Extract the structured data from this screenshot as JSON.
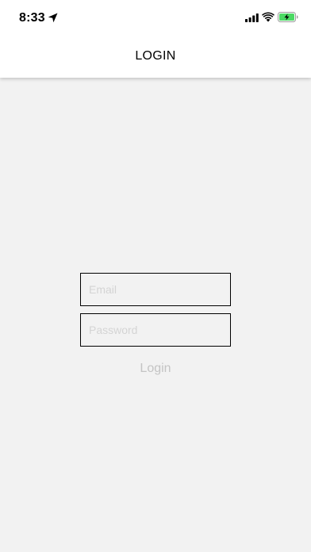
{
  "status_bar": {
    "time": "8:33",
    "icons": [
      "location-arrow-icon",
      "cellular-signal-icon",
      "wifi-icon",
      "battery-charging-icon"
    ],
    "battery_color": "#4cd964"
  },
  "header": {
    "title": "LOGIN"
  },
  "form": {
    "email_placeholder": "Email",
    "email_value": "",
    "password_placeholder": "Password",
    "password_value": "",
    "login_label": "Login"
  },
  "colors": {
    "background": "#f2f2f2",
    "header_background": "#ffffff",
    "field_border": "#000000",
    "disabled_text": "#c4c4c4"
  }
}
